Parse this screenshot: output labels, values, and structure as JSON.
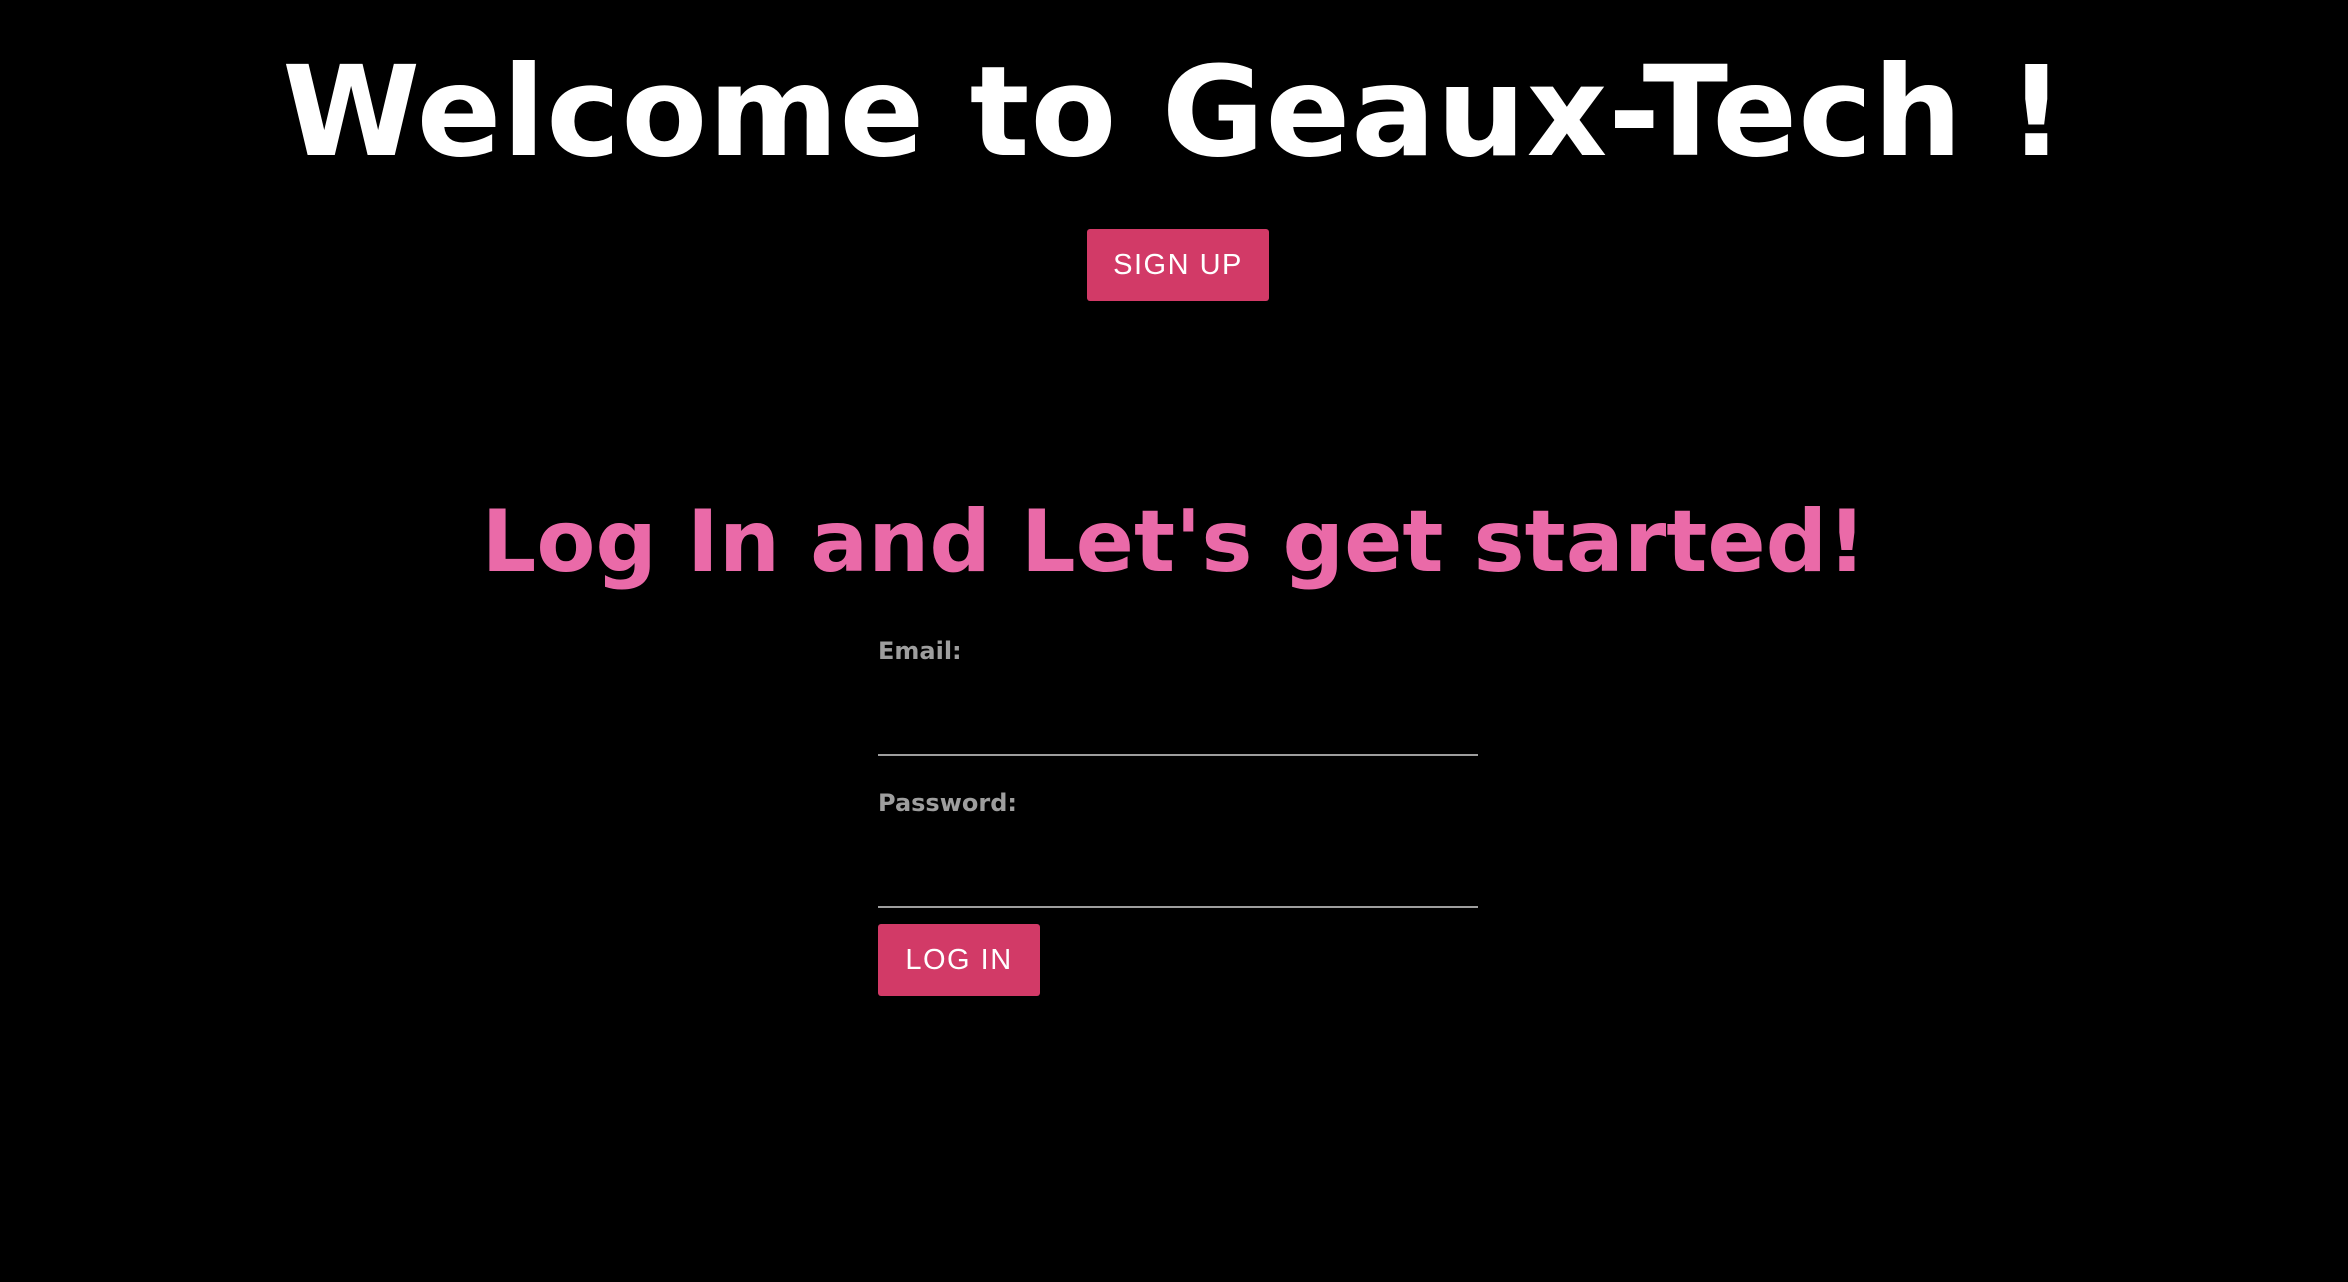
{
  "header": {
    "title": "Welcome to Geaux-Tech !",
    "signup_label": "SIGN UP"
  },
  "login": {
    "title": "Log In and Let's get started!",
    "email_label": "Email:",
    "email_value": "",
    "password_label": "Password:",
    "password_value": "",
    "submit_label": "LOG IN"
  },
  "colors": {
    "background": "#000000",
    "button": "#d23a67",
    "login_title": "#ea6aa8",
    "label": "#9e9e9e"
  }
}
